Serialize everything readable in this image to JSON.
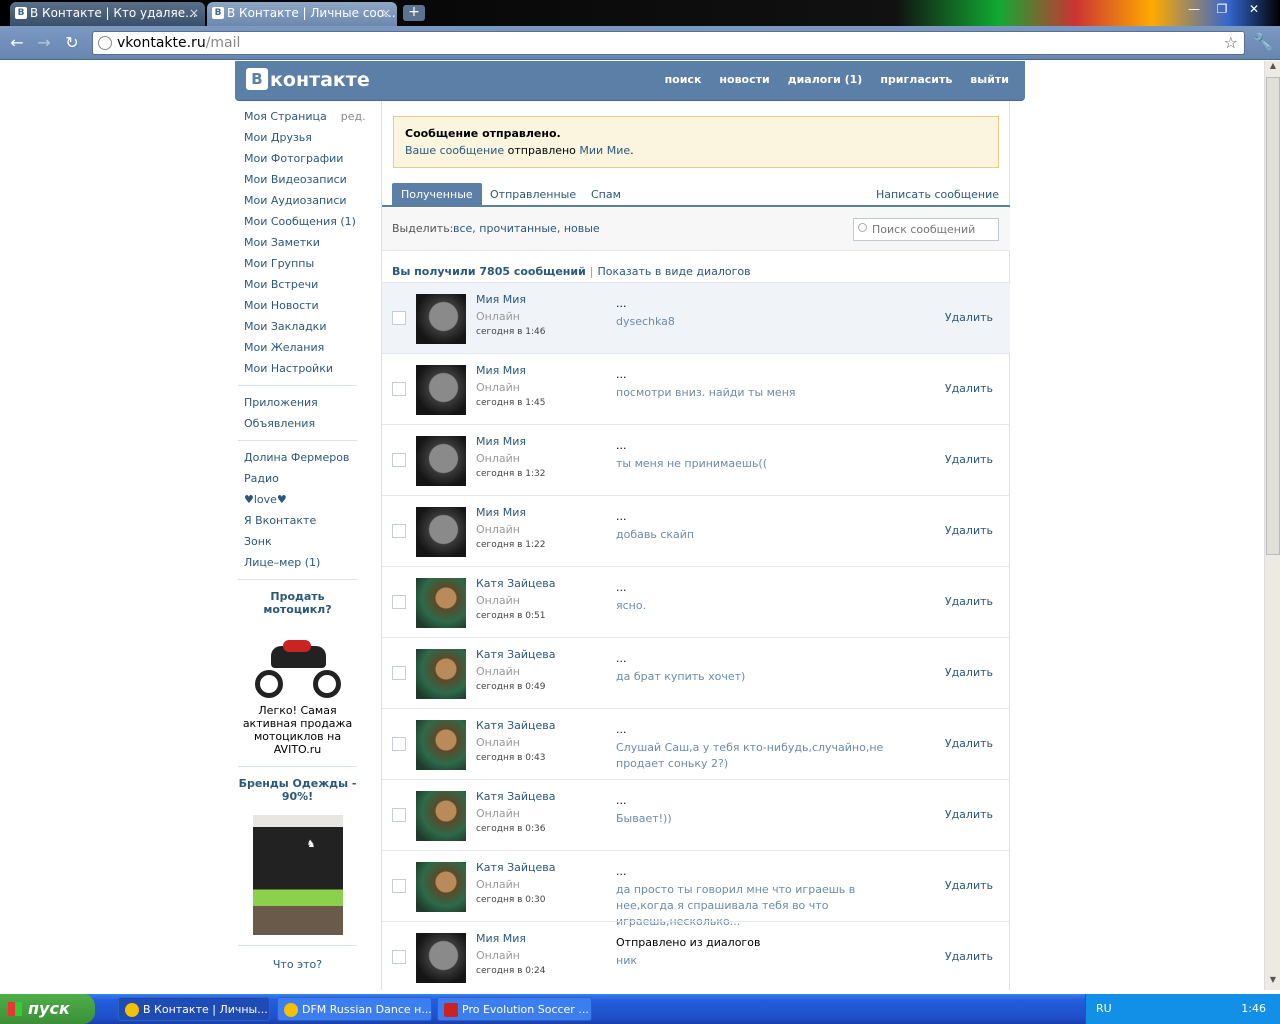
{
  "browser": {
    "tabs": [
      {
        "title": "В Контакте | Кто удаляе...",
        "active": false
      },
      {
        "title": "В Контакте | Личные соо...",
        "active": true
      }
    ],
    "new_tab": "+",
    "window_buttons": [
      "—",
      "❐",
      "✕"
    ],
    "url_host": "vkontakte.ru",
    "url_path": "/mail"
  },
  "vk": {
    "logo_letter": "B",
    "logo_text": "контакте",
    "nav": [
      "поиск",
      "новости",
      "диалоги (1)",
      "пригласить",
      "выйти"
    ]
  },
  "sidebar": {
    "main": [
      {
        "label": "Моя Страница",
        "extra": "ред."
      },
      {
        "label": "Мои Друзья"
      },
      {
        "label": "Мои Фотографии"
      },
      {
        "label": "Мои Видеозаписи"
      },
      {
        "label": "Мои Аудиозаписи"
      },
      {
        "label": "Мои Сообщения (1)"
      },
      {
        "label": "Мои Заметки"
      },
      {
        "label": "Мои Группы"
      },
      {
        "label": "Мои Встречи"
      },
      {
        "label": "Мои Новости"
      },
      {
        "label": "Мои Закладки"
      },
      {
        "label": "Мои Желания"
      },
      {
        "label": "Мои Настройки"
      }
    ],
    "group2": [
      "Приложения",
      "Объявления"
    ],
    "apps": [
      "Долина Фермеров",
      "Радио",
      "♥love♥",
      "Я Вконтакте",
      "Зонк",
      "Лице–мер (1)"
    ],
    "ad1": {
      "title": "Продать мотоцикл?",
      "text": "Легко! Самая активная продажа мотоциклов на AVITO.ru"
    },
    "ad2": {
      "title": "Бренды Одежды - 90%!"
    },
    "ad_what": "Что это?"
  },
  "notice": {
    "title": "Сообщение отправлено.",
    "text_prefix": "Ваше сообщение",
    "text_mid": "отправлено",
    "recipient": "Мии Мие",
    "text_end": "."
  },
  "mail_tabs": [
    "Полученные",
    "Отправленные",
    "Спам"
  ],
  "write_link": "Написать сообщение",
  "filter": {
    "label": "Выделить:",
    "links": "все, прочитанные, новые"
  },
  "search_placeholder": "Поиск сообщений",
  "summary": {
    "count": "Вы получили 7805 сообщений",
    "sep": "|",
    "dialogs": "Показать в виде диалогов"
  },
  "messages": [
    {
      "name": "Мия Мия",
      "status": "Онлайн",
      "date": "сегодня в 1:46",
      "subject": "...",
      "body": "dysechka8",
      "delete": "Удалить",
      "avatar": "mia"
    },
    {
      "name": "Мия Мия",
      "status": "Онлайн",
      "date": "сегодня в 1:45",
      "subject": "...",
      "body": "посмотри вниз. найди ты меня",
      "delete": "Удалить",
      "avatar": "mia"
    },
    {
      "name": "Мия Мия",
      "status": "Онлайн",
      "date": "сегодня в 1:32",
      "subject": "...",
      "body": "ты меня не принимаешь((",
      "delete": "Удалить",
      "avatar": "mia"
    },
    {
      "name": "Мия Мия",
      "status": "Онлайн",
      "date": "сегодня в 1:22",
      "subject": "...",
      "body": "добавь скайп",
      "delete": "Удалить",
      "avatar": "mia"
    },
    {
      "name": "Катя Зайцева",
      "status": "Онлайн",
      "date": "сегодня в 0:51",
      "subject": "...",
      "body": "ясно.",
      "delete": "Удалить",
      "avatar": "katya"
    },
    {
      "name": "Катя Зайцева",
      "status": "Онлайн",
      "date": "сегодня в 0:49",
      "subject": "...",
      "body": "да брат купить хочет)",
      "delete": "Удалить",
      "avatar": "katya"
    },
    {
      "name": "Катя Зайцева",
      "status": "Онлайн",
      "date": "сегодня в 0:43",
      "subject": "...",
      "body": "Слушай Саш,а у тебя кто-нибудь,случайно,не продает соньку 2?)",
      "delete": "Удалить",
      "avatar": "katya"
    },
    {
      "name": "Катя Зайцева",
      "status": "Онлайн",
      "date": "сегодня в 0:36",
      "subject": "...",
      "body": "Бывает!))",
      "delete": "Удалить",
      "avatar": "katya"
    },
    {
      "name": "Катя Зайцева",
      "status": "Онлайн",
      "date": "сегодня в 0:30",
      "subject": "...",
      "body": "да просто ты говорил мне что играешь в нее,когда я спрашивала тебя во что играешь,несколько...",
      "delete": "Удалить",
      "avatar": "katya"
    },
    {
      "name": "Мия Мия",
      "status": "Онлайн",
      "date": "сегодня в 0:24",
      "subject": "Отправлено из диалогов",
      "body": "ник",
      "delete": "Удалить",
      "avatar": "mia"
    }
  ],
  "taskbar": {
    "start": "пуск",
    "tasks": [
      "В Контакте | Личны...",
      "DFM Russian Dance н...",
      "Pro Evolution Soccer ..."
    ],
    "lang": "RU",
    "clock": "1:46"
  }
}
